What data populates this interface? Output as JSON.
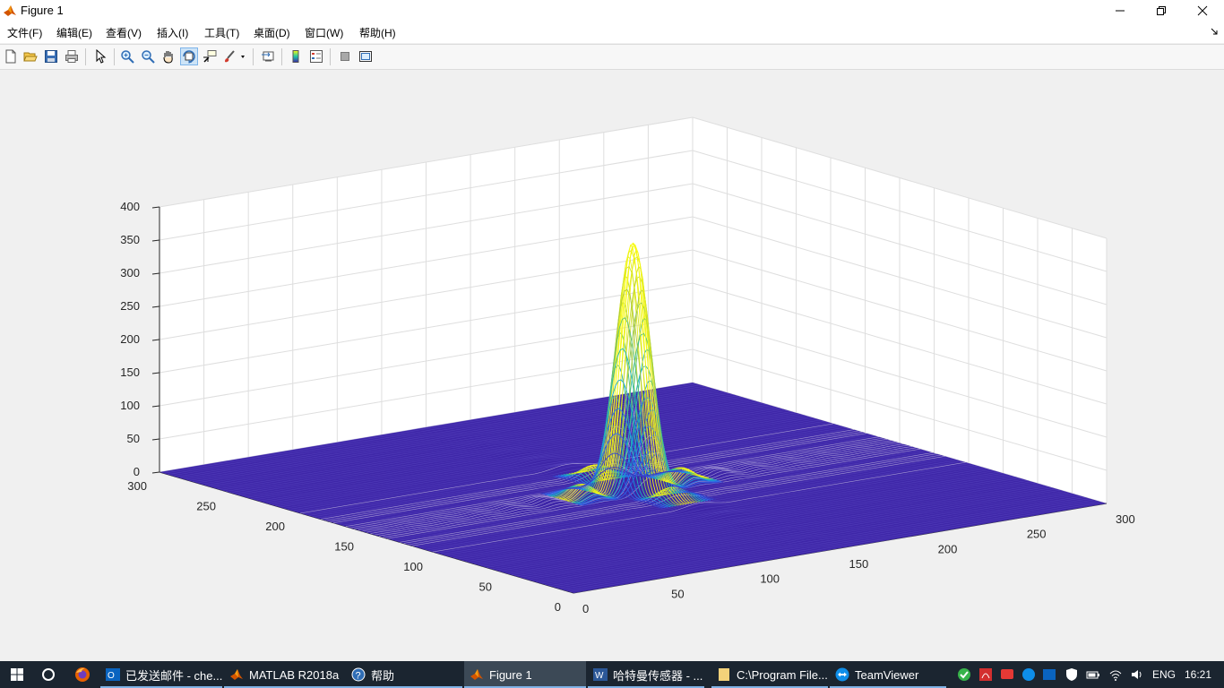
{
  "window": {
    "title": "Figure 1"
  },
  "menu": [
    "文件(F)",
    "编辑(E)",
    "查看(V)",
    "插入(I)",
    "工具(T)",
    "桌面(D)",
    "窗口(W)",
    "帮助(H)"
  ],
  "toolbar": {
    "icons": [
      "new-figure-icon",
      "open-file-icon",
      "save-icon",
      "print-icon",
      "pointer-icon",
      "zoom-in-icon",
      "zoom-out-icon",
      "pan-hand-icon",
      "rotate-3d-icon",
      "data-cursor-icon",
      "brush-icon",
      "link-plot-icon",
      "colorbar-icon",
      "legend-icon",
      "hide-plot-tools-icon",
      "show-plot-tools-icon"
    ],
    "active": "rotate-3d-icon"
  },
  "chart_data": {
    "type": "surface",
    "title": "",
    "z_axis": {
      "ticks": [
        "0",
        "50",
        "100",
        "150",
        "200",
        "250",
        "300",
        "350",
        "400"
      ],
      "range": [
        0,
        400
      ]
    },
    "y_axis": {
      "ticks": [
        "0",
        "50",
        "100",
        "150",
        "200",
        "250",
        "300"
      ],
      "range": [
        0,
        300
      ]
    },
    "x_axis": {
      "ticks": [
        "0",
        "50",
        "100",
        "150",
        "200",
        "250",
        "300"
      ],
      "range": [
        0,
        300
      ]
    },
    "grid": true,
    "colormap": "parula",
    "description_values": {
      "peak_value": 370,
      "peak_center": [
        150,
        150
      ]
    }
  },
  "taskbar": {
    "items": [
      {
        "label": "已发送邮件 - che...",
        "icon": "outlook-icon"
      },
      {
        "label": "MATLAB R2018a",
        "icon": "matlab-icon"
      },
      {
        "label": "帮助",
        "icon": "help-icon"
      },
      {
        "label": "Figure 1",
        "icon": "matlab-figure-icon",
        "active": true
      },
      {
        "label": "哈特曼传感器 - ...",
        "icon": "word-icon"
      },
      {
        "label": "C:\\Program File...",
        "icon": "folder-icon"
      },
      {
        "label": "TeamViewer",
        "icon": "teamviewer-icon"
      }
    ],
    "tray": {
      "language": "ENG",
      "time": "16:21"
    }
  }
}
